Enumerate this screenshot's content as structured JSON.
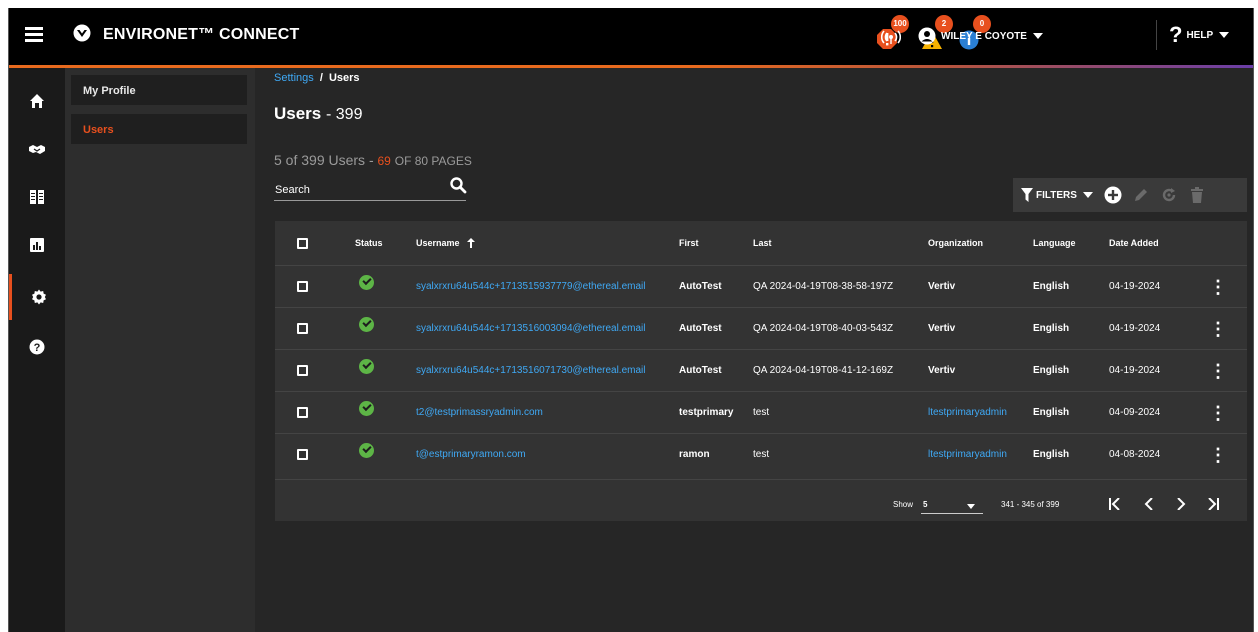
{
  "app": {
    "title": "ENVIRONET™ CONNECT"
  },
  "alerts": [
    {
      "name": "critical-alarms",
      "count": "100",
      "color": "#e8501e"
    },
    {
      "name": "warning-alarms",
      "count": "2",
      "color": "#f5b100"
    },
    {
      "name": "info-alarms",
      "count": "0",
      "color": "#2a7fd4"
    }
  ],
  "user": {
    "name": "WILEY E COYOTE"
  },
  "help": {
    "label": "HELP"
  },
  "rail": [
    "home-icon",
    "handshake-icon",
    "inventory-icon",
    "reports-icon",
    "settings-icon",
    "help-circle-icon"
  ],
  "subnav": {
    "items": [
      {
        "label": "My Profile"
      },
      {
        "label": "Users"
      }
    ]
  },
  "breadcrumb": {
    "parent": "Settings",
    "separator": "/",
    "current": "Users"
  },
  "page": {
    "title": "Users",
    "count": "- 399"
  },
  "summary": {
    "shown": "5 of 399 Users -",
    "page": "69",
    "of_pages": "OF 80 PAGES"
  },
  "search": {
    "placeholder": "Search"
  },
  "toolbar": {
    "filters_label": "FILTERS"
  },
  "table": {
    "columns": {
      "status": "Status",
      "username": "Username",
      "first": "First",
      "last": "Last",
      "organization": "Organization",
      "language": "Language",
      "date_added": "Date Added"
    },
    "rows": [
      {
        "username": "syalxrxru64u544c+1713515937779@ethereal.email",
        "first": "AutoTest",
        "last": "QA 2024-04-19T08-38-58-197Z",
        "organization": "Vertiv",
        "org_link": false,
        "language": "English",
        "date": "04-19-2024"
      },
      {
        "username": "syalxrxru64u544c+1713516003094@ethereal.email",
        "first": "AutoTest",
        "last": "QA 2024-04-19T08-40-03-543Z",
        "organization": "Vertiv",
        "org_link": false,
        "language": "English",
        "date": "04-19-2024"
      },
      {
        "username": "syalxrxru64u544c+1713516071730@ethereal.email",
        "first": "AutoTest",
        "last": "QA 2024-04-19T08-41-12-169Z",
        "organization": "Vertiv",
        "org_link": false,
        "language": "English",
        "date": "04-19-2024"
      },
      {
        "username": "t2@testprimassryadmin.com",
        "first": "testprimary",
        "last": "test",
        "organization": "ltestprimaryadmin",
        "org_link": true,
        "language": "English",
        "date": "04-09-2024"
      },
      {
        "username": "t@estprimaryramon.com",
        "first": "ramon",
        "last": "test",
        "organization": "ltestprimaryadmin",
        "org_link": true,
        "language": "English",
        "date": "04-08-2024"
      }
    ]
  },
  "pagination": {
    "show_label": "Show",
    "page_size": "5",
    "range": "341 - 345 of 399"
  }
}
